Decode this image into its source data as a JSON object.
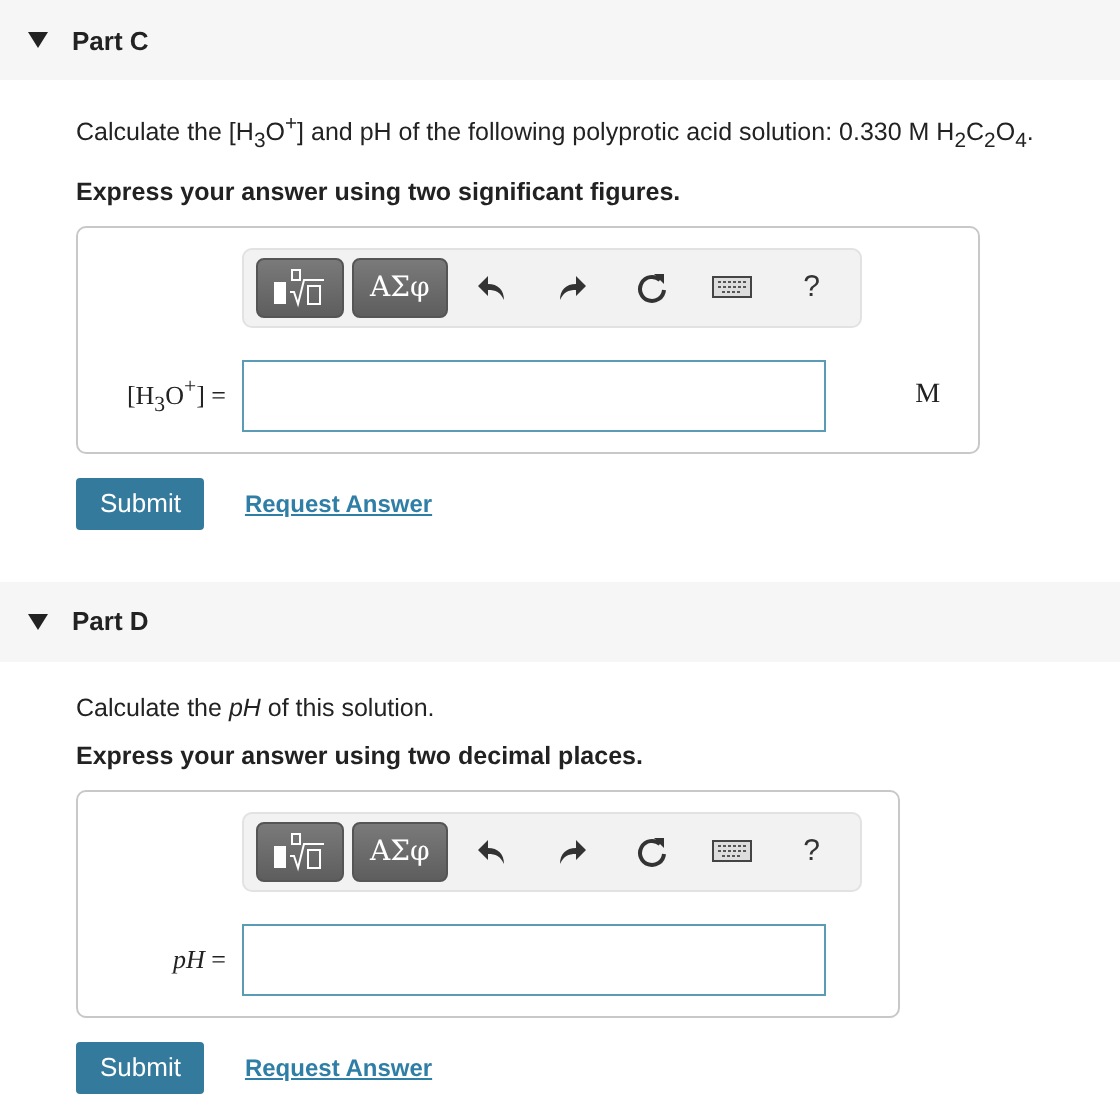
{
  "parts": [
    {
      "title": "Part C",
      "expanded": true,
      "prompt": "Calculate the [H$_{3}$O$^{+}$] and pH of the following polyprotic acid solution: 0.330 M H$_{2}$C$_{2}$O$_{4}$.",
      "instruction": "Express your answer using two significant figures.",
      "toolbar": {
        "symbols": "ΑΣφ",
        "help": "?"
      },
      "label": "[H$_{3}$O$^{+}$] =",
      "unit": "M",
      "submit": "Submit",
      "request": "Request Answer"
    },
    {
      "title": "Part D",
      "expanded": true,
      "prompt": "Calculate the *pH* of this solution.",
      "instruction": "Express your answer using two decimal places.",
      "toolbar": {
        "symbols": "ΑΣφ",
        "help": "?"
      },
      "label": "*pH* =",
      "submit": "Submit",
      "request": "Request Answer"
    }
  ]
}
